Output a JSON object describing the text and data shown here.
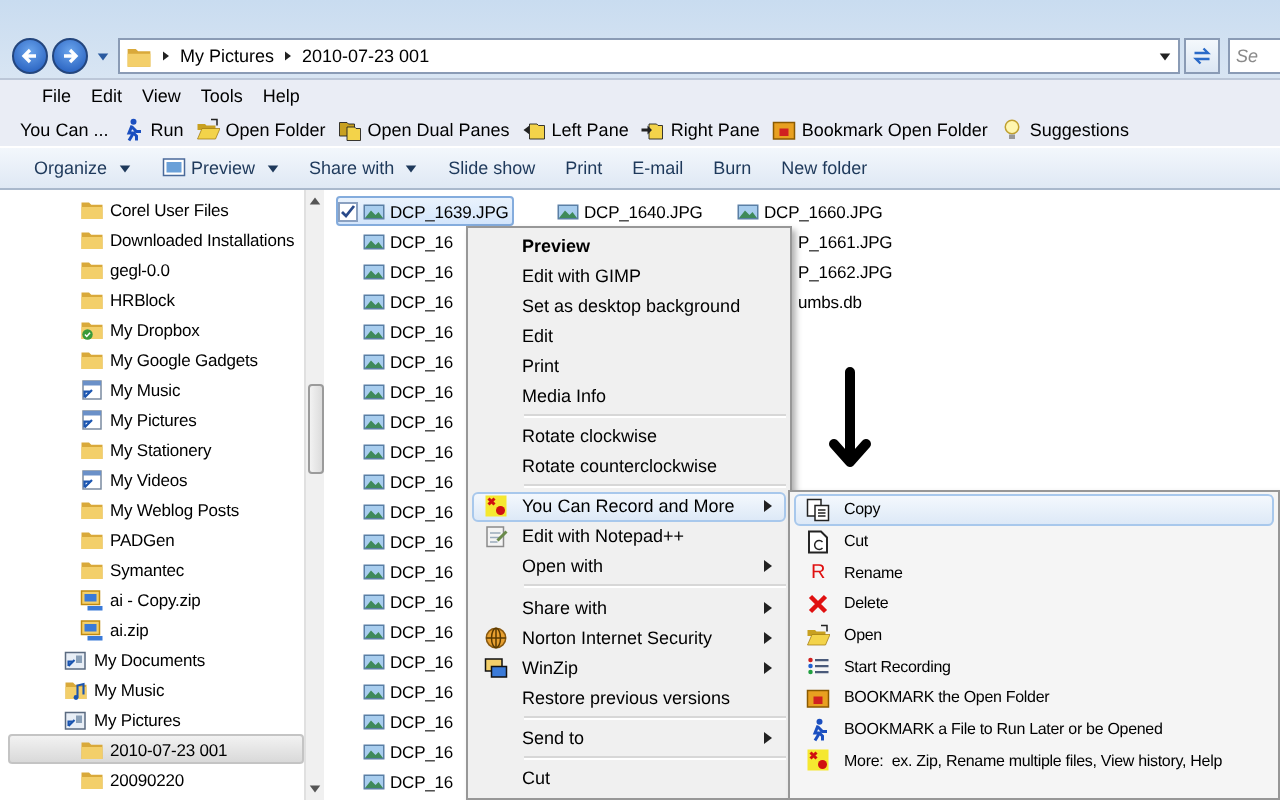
{
  "address_bar": {
    "path": [
      "My Pictures",
      "2010-07-23 001"
    ],
    "search_placeholder": "Se"
  },
  "menu_bar": [
    "File",
    "Edit",
    "View",
    "Tools",
    "Help"
  ],
  "toolbar": [
    {
      "label": "You Can ...",
      "kind": "text"
    },
    {
      "label": "Run",
      "kind": "run"
    },
    {
      "label": "Open Folder",
      "kind": "open-folder"
    },
    {
      "label": "Open Dual Panes",
      "kind": "dual-panes"
    },
    {
      "label": "Left Pane",
      "kind": "left-pane"
    },
    {
      "label": "Right Pane",
      "kind": "right-pane"
    },
    {
      "label": "Bookmark Open Folder",
      "kind": "bookmark"
    },
    {
      "label": "Suggestions",
      "kind": "bulb"
    }
  ],
  "command_bar": [
    {
      "label": "Organize",
      "kind": "plain",
      "dropdown": true
    },
    {
      "label": "Preview",
      "kind": "preview",
      "dropdown": true
    },
    {
      "label": "Share with",
      "kind": "plain",
      "dropdown": true
    },
    {
      "label": "Slide show",
      "kind": "plain",
      "dropdown": false
    },
    {
      "label": "Print",
      "kind": "plain",
      "dropdown": false
    },
    {
      "label": "E-mail",
      "kind": "plain",
      "dropdown": false
    },
    {
      "label": "Burn",
      "kind": "plain",
      "dropdown": false
    },
    {
      "label": "New folder",
      "kind": "plain",
      "dropdown": false
    }
  ],
  "nav_tree": {
    "continued_children": [
      {
        "label": "Corel User Files",
        "kind": "folder",
        "selected": false
      },
      {
        "label": "Downloaded Installations",
        "kind": "folder",
        "selected": false
      },
      {
        "label": "gegl-0.0",
        "kind": "folder",
        "selected": false
      },
      {
        "label": "HRBlock",
        "kind": "folder",
        "selected": false
      },
      {
        "label": "My Dropbox",
        "kind": "dropbox",
        "selected": false
      },
      {
        "label": "My Google Gadgets",
        "kind": "folder",
        "selected": false
      },
      {
        "label": "My Music",
        "kind": "shortcut",
        "selected": false
      },
      {
        "label": "My Pictures",
        "kind": "shortcut",
        "selected": false
      },
      {
        "label": "My Stationery",
        "kind": "folder",
        "selected": false
      },
      {
        "label": "My Videos",
        "kind": "shortcut",
        "selected": false
      },
      {
        "label": "My Weblog Posts",
        "kind": "folder",
        "selected": false
      },
      {
        "label": "PADGen",
        "kind": "folder",
        "selected": false
      },
      {
        "label": "Symantec",
        "kind": "folder",
        "selected": false
      },
      {
        "label": "ai - Copy.zip",
        "kind": "zip",
        "selected": false
      },
      {
        "label": "ai.zip",
        "kind": "zip",
        "selected": false
      }
    ],
    "items": [
      {
        "label": "My Documents",
        "kind": "library",
        "selected": false
      },
      {
        "label": "My Music",
        "kind": "music",
        "selected": false
      },
      {
        "label": "My Pictures",
        "kind": "library",
        "selected": false,
        "children": [
          {
            "label": "2010-07-23 001",
            "kind": "folder",
            "selected": true
          },
          {
            "label": "20090220",
            "kind": "folder",
            "selected": false
          }
        ]
      }
    ]
  },
  "files": {
    "columns": [
      [
        {
          "name": "DCP_1639.JPG",
          "kind": "file",
          "selected": true
        },
        {
          "name": "DCP_16",
          "kind": "file",
          "selected": false
        },
        {
          "name": "DCP_16",
          "kind": "file",
          "selected": false
        },
        {
          "name": "DCP_16",
          "kind": "file",
          "selected": false
        },
        {
          "name": "DCP_16",
          "kind": "file",
          "selected": false
        },
        {
          "name": "DCP_16",
          "kind": "file",
          "selected": false
        },
        {
          "name": "DCP_16",
          "kind": "file",
          "selected": false
        },
        {
          "name": "DCP_16",
          "kind": "file",
          "selected": false
        },
        {
          "name": "DCP_16",
          "kind": "file",
          "selected": false
        },
        {
          "name": "DCP_16",
          "kind": "file",
          "selected": false
        },
        {
          "name": "DCP_16",
          "kind": "file",
          "selected": false
        },
        {
          "name": "DCP_16",
          "kind": "file",
          "selected": false
        },
        {
          "name": "DCP_16",
          "kind": "file",
          "selected": false
        },
        {
          "name": "DCP_16",
          "kind": "file",
          "selected": false
        },
        {
          "name": "DCP_16",
          "kind": "file",
          "selected": false
        },
        {
          "name": "DCP_16",
          "kind": "file",
          "selected": false
        },
        {
          "name": "DCP_16",
          "kind": "file",
          "selected": false
        },
        {
          "name": "DCP_16",
          "kind": "file",
          "selected": false
        },
        {
          "name": "DCP_16",
          "kind": "file",
          "selected": false
        },
        {
          "name": "DCP_16",
          "kind": "file",
          "selected": false
        }
      ],
      [
        {
          "name": "DCP_1640.JPG",
          "kind": "file",
          "selected": false
        }
      ],
      [
        {
          "name": "DCP_1660.JPG",
          "kind": "file",
          "selected": false
        },
        {
          "name": "P_1661.JPG",
          "kind": "partial",
          "selected": false
        },
        {
          "name": "P_1662.JPG",
          "kind": "partial",
          "selected": false
        },
        {
          "name": "umbs.db",
          "kind": "partial",
          "selected": false
        }
      ]
    ]
  },
  "context_menu": {
    "items": [
      {
        "label": "Preview",
        "kind": "plain",
        "default": true,
        "submenu": false,
        "highlighted": false
      },
      {
        "label": "Edit with GIMP",
        "kind": "plain",
        "default": false,
        "submenu": false,
        "highlighted": false
      },
      {
        "label": "Set as desktop background",
        "kind": "plain",
        "default": false,
        "submenu": false,
        "highlighted": false
      },
      {
        "label": "Edit",
        "kind": "plain",
        "default": false,
        "submenu": false,
        "highlighted": false
      },
      {
        "label": "Print",
        "kind": "plain",
        "default": false,
        "submenu": false,
        "highlighted": false
      },
      {
        "label": "Media Info",
        "kind": "plain",
        "default": false,
        "submenu": false,
        "highlighted": false
      },
      {
        "kind": "separator"
      },
      {
        "label": "Rotate clockwise",
        "kind": "plain",
        "default": false,
        "submenu": false,
        "highlighted": false
      },
      {
        "label": "Rotate counterclockwise",
        "kind": "plain",
        "default": false,
        "submenu": false,
        "highlighted": false
      },
      {
        "kind": "separator"
      },
      {
        "label": "You Can Record and More",
        "kind": "record",
        "default": false,
        "submenu": true,
        "highlighted": true
      },
      {
        "label": "Edit with Notepad++",
        "kind": "notepad",
        "default": false,
        "submenu": false,
        "highlighted": false
      },
      {
        "label": "Open with",
        "kind": "plain",
        "default": false,
        "submenu": true,
        "highlighted": false
      },
      {
        "kind": "separator"
      },
      {
        "label": "Share with",
        "kind": "plain",
        "default": false,
        "submenu": true,
        "highlighted": false
      },
      {
        "label": "Norton Internet Security",
        "kind": "norton",
        "default": false,
        "submenu": true,
        "highlighted": false
      },
      {
        "label": "WinZip",
        "kind": "winzip",
        "default": false,
        "submenu": true,
        "highlighted": false
      },
      {
        "label": "Restore previous versions",
        "kind": "plain",
        "default": false,
        "submenu": false,
        "highlighted": false
      },
      {
        "kind": "separator"
      },
      {
        "label": "Send to",
        "kind": "plain",
        "default": false,
        "submenu": true,
        "highlighted": false
      },
      {
        "kind": "separator"
      },
      {
        "label": "Cut",
        "kind": "plain",
        "default": false,
        "submenu": false,
        "highlighted": false
      }
    ]
  },
  "submenu": {
    "items": [
      {
        "label": "Copy",
        "kind": "copy",
        "highlighted": true
      },
      {
        "label": "Cut",
        "kind": "cut",
        "highlighted": false
      },
      {
        "label": "Rename",
        "kind": "glyph",
        "glyph": "R",
        "highlighted": false
      },
      {
        "label": "Delete",
        "kind": "delete",
        "highlighted": false
      },
      {
        "label": "Open",
        "kind": "open-folder",
        "highlighted": false
      },
      {
        "label": "Start Recording",
        "kind": "list",
        "highlighted": false
      },
      {
        "label": "BOOKMARK the Open Folder",
        "kind": "bookmark",
        "highlighted": false
      },
      {
        "label": "BOOKMARK a File to Run Later or be Opened",
        "kind": "run",
        "highlighted": false
      },
      {
        "label": "More:  ex. Zip, Rename multiple files, View history, Help",
        "kind": "record",
        "highlighted": false
      }
    ]
  }
}
